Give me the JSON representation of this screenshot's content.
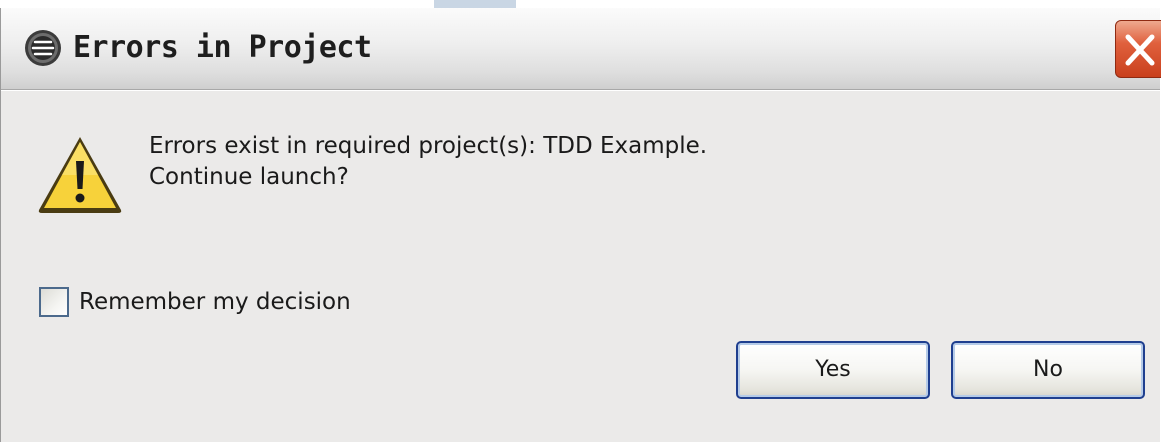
{
  "window": {
    "title": "Errors in Project",
    "app_icon": "eclipse-icon",
    "close_icon": "close-icon"
  },
  "message": {
    "icon": "warning-icon",
    "line1": "Errors exist in required project(s): TDD Example.",
    "line2": "Continue launch?"
  },
  "remember": {
    "label": "Remember my decision",
    "checked": false
  },
  "buttons": {
    "yes_label": "Yes",
    "no_label": "No"
  },
  "colors": {
    "dialog_bg": "#ebeae9",
    "button_border": "#1f3f8f",
    "close_red": "#d9522f",
    "warning_yellow": "#f7d23a"
  }
}
